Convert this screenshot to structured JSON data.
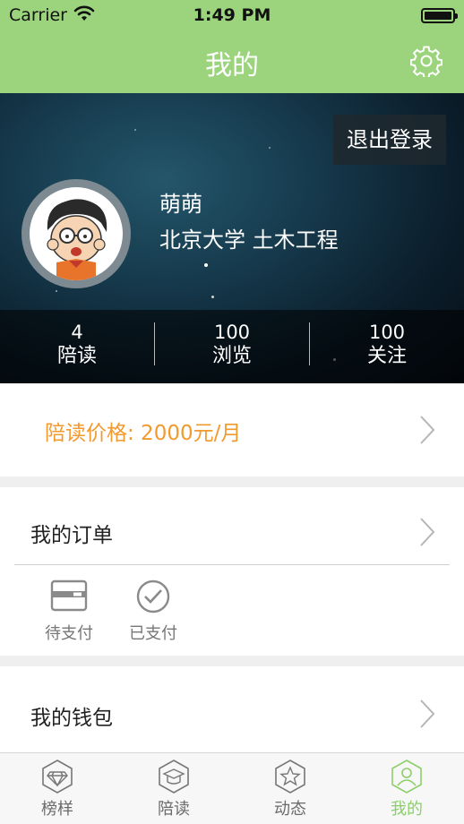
{
  "status_bar": {
    "carrier": "Carrier",
    "time": "1:49 PM"
  },
  "nav": {
    "title": "我的",
    "settings_icon": "gear-icon"
  },
  "profile": {
    "logout_label": "退出登录",
    "name": "萌萌",
    "school": "北京大学 土木工程",
    "stats": [
      {
        "value": "4",
        "label": "陪读"
      },
      {
        "value": "100",
        "label": "浏览"
      },
      {
        "value": "100",
        "label": "关注"
      }
    ]
  },
  "price": {
    "label": "陪读价格: 2000元/月",
    "color": "#f29a2e"
  },
  "orders": {
    "title": "我的订单",
    "items": [
      {
        "label": "待支付",
        "icon": "card-icon"
      },
      {
        "label": "已支付",
        "icon": "check-circle-icon"
      }
    ]
  },
  "wallet": {
    "title": "我的钱包"
  },
  "tabbar": {
    "items": [
      {
        "label": "榜样",
        "icon": "diamond-icon",
        "active": false
      },
      {
        "label": "陪读",
        "icon": "graduation-cap-icon",
        "active": false
      },
      {
        "label": "动态",
        "icon": "star-icon",
        "active": false
      },
      {
        "label": "我的",
        "icon": "user-icon",
        "active": true
      }
    ],
    "active_color": "#8ccf6a"
  },
  "colors": {
    "header_green": "#9bd47c",
    "accent_orange": "#f29a2e"
  }
}
